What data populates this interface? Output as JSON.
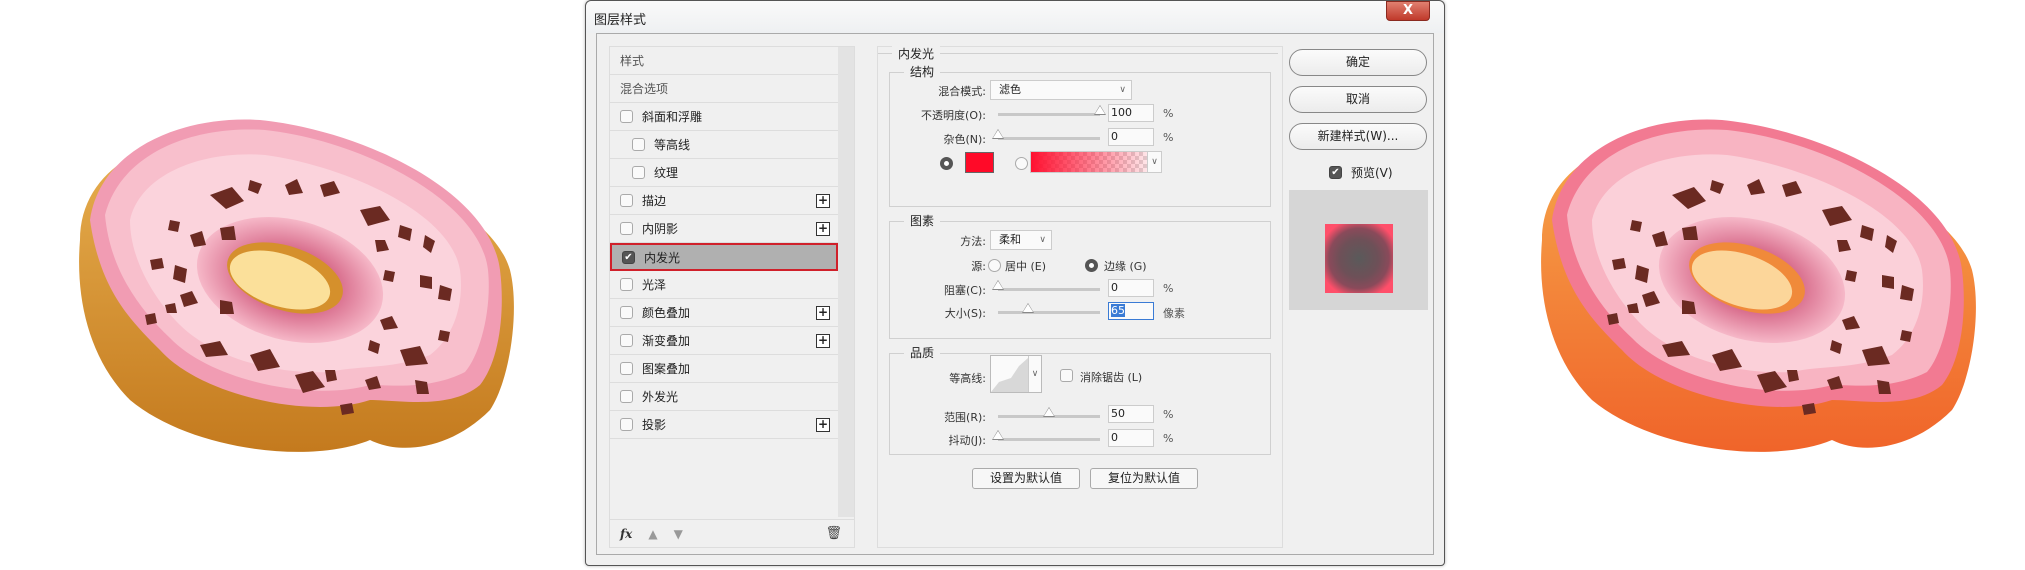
{
  "dialog": {
    "title": "图层样式",
    "close_label": "X"
  },
  "styles_list": [
    {
      "label": "样式",
      "type": "header"
    },
    {
      "label": "混合选项",
      "type": "header"
    },
    {
      "label": "斜面和浮雕",
      "checked": false,
      "plus": false,
      "indent": false
    },
    {
      "label": "等高线",
      "checked": false,
      "plus": false,
      "indent": true
    },
    {
      "label": "纹理",
      "checked": false,
      "plus": false,
      "indent": true
    },
    {
      "label": "描边",
      "checked": false,
      "plus": true,
      "indent": false
    },
    {
      "label": "内阴影",
      "checked": false,
      "plus": true,
      "indent": false
    },
    {
      "label": "内发光",
      "checked": true,
      "plus": false,
      "indent": false,
      "selected": true
    },
    {
      "label": "光泽",
      "checked": false,
      "plus": false,
      "indent": false
    },
    {
      "label": "颜色叠加",
      "checked": false,
      "plus": true,
      "indent": false
    },
    {
      "label": "渐变叠加",
      "checked": false,
      "plus": true,
      "indent": false
    },
    {
      "label": "图案叠加",
      "checked": false,
      "plus": false,
      "indent": false
    },
    {
      "label": "外发光",
      "checked": false,
      "plus": false,
      "indent": false
    },
    {
      "label": "投影",
      "checked": false,
      "plus": true,
      "indent": false
    }
  ],
  "footer": {
    "fx": "fx",
    "up": "▲",
    "down": "▼",
    "trash": "🗑"
  },
  "inner_glow": {
    "title": "内发光",
    "structure": {
      "title": "结构",
      "blend_label": "混合模式:",
      "blend_value": "滤色",
      "opacity_label": "不透明度(O):",
      "opacity": "100",
      "noise_label": "杂色(N):",
      "noise": "0",
      "percent": "%",
      "glow_color": "#ff0a28"
    },
    "elements": {
      "title": "图素",
      "method_label": "方法:",
      "method_value": "柔和",
      "source_label": "源:",
      "center_label": "居中 (E)",
      "edge_label": "边缘 (G)",
      "choke_label": "阻塞(C):",
      "choke": "0",
      "size_label": "大小(S):",
      "size": "65",
      "px_unit": "像素"
    },
    "quality": {
      "title": "品质",
      "contour_label": "等高线:",
      "antialias_label": "消除锯齿 (L)",
      "range_label": "范围(R):",
      "range": "50",
      "jitter_label": "抖动(J):",
      "jitter": "0"
    },
    "make_default": "设置为默认值",
    "reset_default": "复位为默认值"
  },
  "buttons": {
    "ok": "确定",
    "cancel": "取消",
    "new_style": "新建样式(W)...",
    "preview_label": "预览(V)"
  }
}
